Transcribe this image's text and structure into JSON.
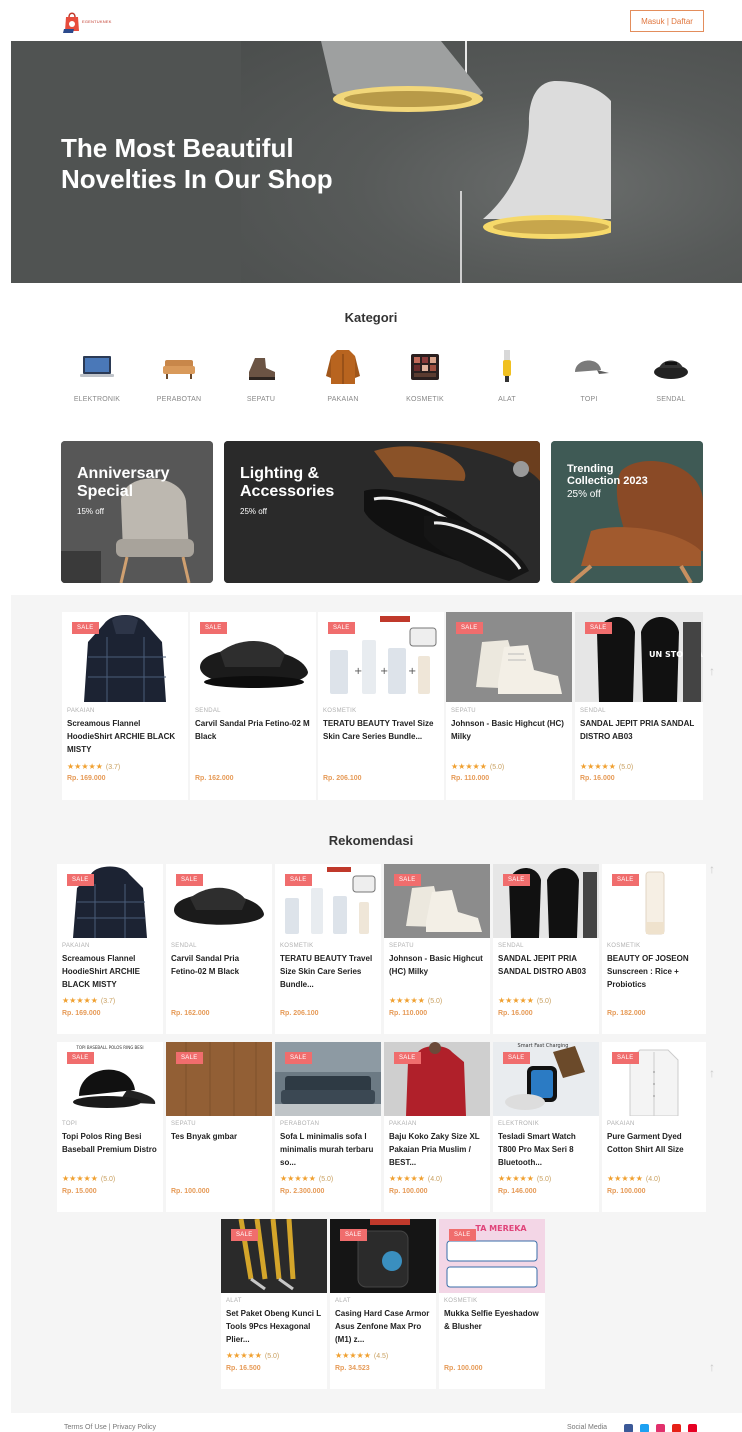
{
  "header": {
    "logo_text": "EGENTUKNEK",
    "login_label": "Masuk | Daftar"
  },
  "hero": {
    "title": "The Most Beautiful Novelties In Our Shop"
  },
  "categories": {
    "title": "Kategori",
    "items": [
      {
        "label": "ELEKTRONIK",
        "icon": "laptop-icon"
      },
      {
        "label": "PERABOTAN",
        "icon": "sofa-icon"
      },
      {
        "label": "SEPATU",
        "icon": "boot-icon"
      },
      {
        "label": "PAKAIAN",
        "icon": "jacket-icon"
      },
      {
        "label": "KOSMETIK",
        "icon": "eyeshadow-palette-icon"
      },
      {
        "label": "ALAT",
        "icon": "tool-icon"
      },
      {
        "label": "TOPI",
        "icon": "cap-icon"
      },
      {
        "label": "SENDAL",
        "icon": "sandal-icon"
      }
    ]
  },
  "promos": [
    {
      "title": "Anniversary Special",
      "subtitle": "15% off"
    },
    {
      "title": "Lighting & Accessories",
      "subtitle": "25% off"
    },
    {
      "title": "Trending Collection 2023",
      "subtitle": "25% off"
    }
  ],
  "sale_badge": "SALE",
  "top_products": [
    {
      "category": "PAKAIAN",
      "name": "Screamous Flannel HoodieShirt ARCHIE BLACK MISTY",
      "stars": "★★★★★",
      "rating": "(3.7)",
      "price": "Rp. 169.000"
    },
    {
      "category": "SENDAL",
      "name": "Carvil Sandal Pria Fetino-02 M Black",
      "stars": "",
      "rating": "",
      "price": "Rp. 162.000"
    },
    {
      "category": "KOSMETIK",
      "name": "TERATU BEAUTY Travel Size Skin Care Series Bundle...",
      "stars": "",
      "rating": "",
      "price": "Rp. 206.100"
    },
    {
      "category": "SEPATU",
      "name": "Johnson - Basic Highcut (HC) Milky",
      "stars": "★★★★★",
      "rating": "(5.0)",
      "price": "Rp. 110.000"
    },
    {
      "category": "SENDAL",
      "name": "SANDAL JEPIT PRIA SANDAL DISTRO AB03",
      "stars": "★★★★★",
      "rating": "(5.0)",
      "price": "Rp. 16.000"
    }
  ],
  "recommend": {
    "title": "Rekomendasi",
    "row1": [
      {
        "category": "PAKAIAN",
        "name": "Screamous Flannel HoodieShirt ARCHIE BLACK MISTY",
        "stars": "★★★★★",
        "rating": "(3.7)",
        "price": "Rp. 169.000"
      },
      {
        "category": "SENDAL",
        "name": "Carvil Sandal Pria Fetino-02 M Black",
        "stars": "",
        "rating": "",
        "price": "Rp. 162.000"
      },
      {
        "category": "KOSMETIK",
        "name": "TERATU BEAUTY Travel Size Skin Care Series Bundle...",
        "stars": "",
        "rating": "",
        "price": "Rp. 206.100"
      },
      {
        "category": "SEPATU",
        "name": "Johnson - Basic Highcut (HC) Milky",
        "stars": "★★★★★",
        "rating": "(5.0)",
        "price": "Rp. 110.000"
      },
      {
        "category": "SENDAL",
        "name": "SANDAL JEPIT PRIA SANDAL DISTRO AB03",
        "stars": "★★★★★",
        "rating": "(5.0)",
        "price": "Rp. 16.000"
      },
      {
        "category": "KOSMETIK",
        "name": "BEAUTY OF JOSEON Sunscreen : Rice + Probiotics",
        "stars": "",
        "rating": "",
        "price": "Rp. 182.000"
      }
    ],
    "row2": [
      {
        "category": "TOPI",
        "name": "Topi Polos Ring Besi Baseball Premium Distro",
        "stars": "★★★★★",
        "rating": "(5.0)",
        "price": "Rp. 15.000"
      },
      {
        "category": "SEPATU",
        "name": "Tes Bnyak gmbar",
        "stars": "",
        "rating": "",
        "price": "Rp. 100.000"
      },
      {
        "category": "PERABOTAN",
        "name": "Sofa L minimalis sofa l minimalis murah terbaru so...",
        "stars": "★★★★★",
        "rating": "(5.0)",
        "price": "Rp. 2.300.000"
      },
      {
        "category": "PAKAIAN",
        "name": "Baju Koko Zaky Size XL Pakaian Pria Muslim / BEST...",
        "stars": "★★★★★",
        "rating": "(4.0)",
        "price": "Rp. 100.000"
      },
      {
        "category": "ELEKTRONIK",
        "name": "Tesladi Smart Watch T800 Pro Max Seri 8 Bluetooth...",
        "stars": "★★★★★",
        "rating": "(5.0)",
        "price": "Rp. 146.000"
      },
      {
        "category": "PAKAIAN",
        "name": "Pure Garment Dyed Cotton Shirt All Size",
        "stars": "★★★★★",
        "rating": "(4.0)",
        "price": "Rp. 100.000"
      }
    ],
    "row3": [
      {
        "category": "ALAT",
        "name": "Set Paket Obeng Kunci L Tools 9Pcs Hexagonal Plier...",
        "stars": "★★★★★",
        "rating": "(5.0)",
        "price": "Rp. 16.500"
      },
      {
        "category": "ALAT",
        "name": "Casing Hard Case Armor Asus Zenfone Max Pro (M1) z...",
        "stars": "★★★★★",
        "rating": "(4.5)",
        "price": "Rp. 34.523"
      },
      {
        "category": "KOSMETIK",
        "name": "Mukka Selfie Eyeshadow & Blusher",
        "stars": "",
        "rating": "",
        "price": "Rp. 100.000"
      }
    ]
  },
  "image_text": {
    "cap_banner": "TOPI BASEBALL POLOS RING BESI",
    "watch_banner": "Smart Fast Charging",
    "eyeshadow_banner": "TA MEREKA",
    "sandal_print": "UN STOP PABLE"
  },
  "footer": {
    "links": "Terms Of Use  |  Privacy Policy",
    "social_label": "Social Media"
  },
  "colors": {
    "accent": "#e0763e",
    "sale": "#f06d6d",
    "price": "#e69b58",
    "star": "#f0a030"
  }
}
